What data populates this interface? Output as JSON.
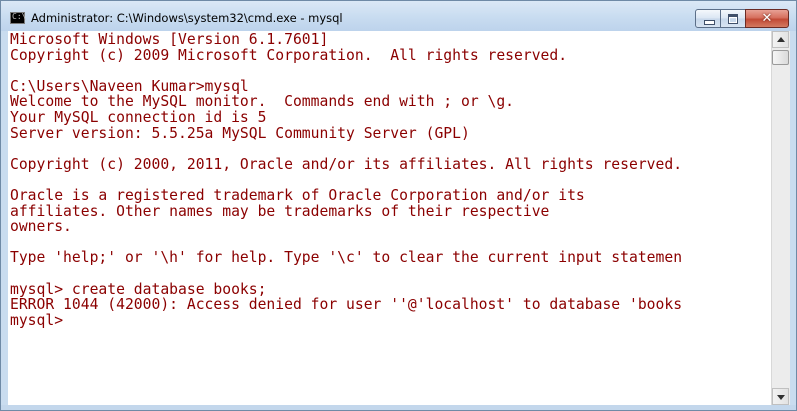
{
  "window": {
    "title": "Administrator: C:\\Windows\\system32\\cmd.exe - mysql",
    "icon": "cmd-icon",
    "icon_glyph": "C:\\",
    "buttons": {
      "minimize": "minimize-icon",
      "maximize": "maximize-icon",
      "close": "close-icon",
      "close_glyph": "✕"
    }
  },
  "console": {
    "text_color": "#8b0000",
    "background_color": "#ffffff",
    "lines": [
      "Microsoft Windows [Version 6.1.7601]",
      "Copyright (c) 2009 Microsoft Corporation.  All rights reserved.",
      "",
      "C:\\Users\\Naveen Kumar>mysql",
      "Welcome to the MySQL monitor.  Commands end with ; or \\g.",
      "Your MySQL connection id is 5",
      "Server version: 5.5.25a MySQL Community Server (GPL)",
      "",
      "Copyright (c) 2000, 2011, Oracle and/or its affiliates. All rights reserved.",
      "",
      "Oracle is a registered trademark of Oracle Corporation and/or its",
      "affiliates. Other names may be trademarks of their respective",
      "owners.",
      "",
      "Type 'help;' or '\\h' for help. Type '\\c' to clear the current input statemen",
      "",
      "mysql> create database books;",
      "ERROR 1044 (42000): Access denied for user ''@'localhost' to database 'books",
      "mysql>"
    ]
  },
  "scrollbar": {
    "up_icon": "scroll-up-arrow-icon",
    "down_icon": "scroll-down-arrow-icon",
    "position": 0
  }
}
